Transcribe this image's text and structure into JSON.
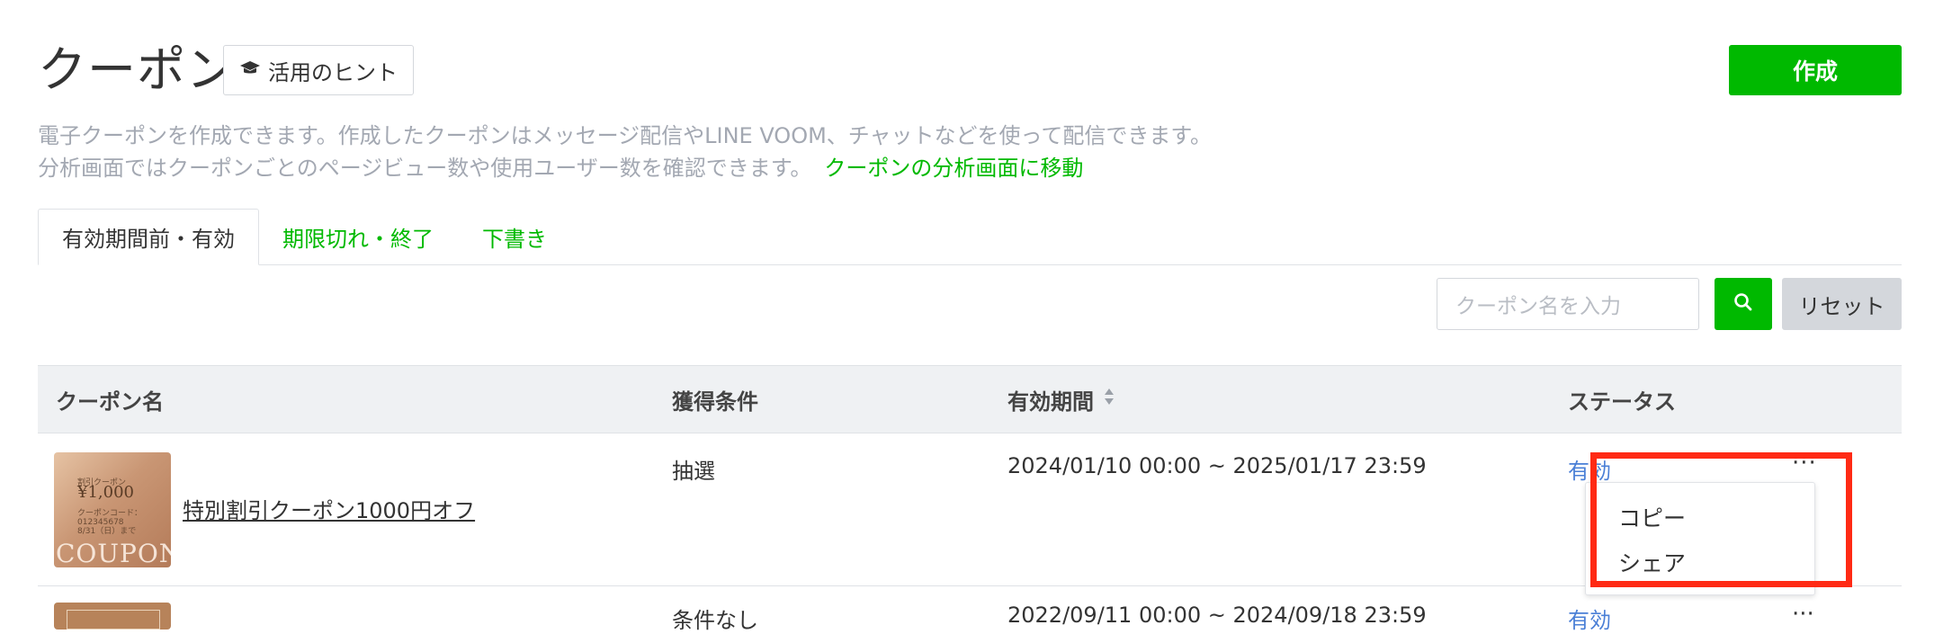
{
  "header": {
    "title": "クーポン",
    "hint_label": "活用のヒント",
    "create_label": "作成"
  },
  "description": {
    "line1": "電子クーポンを作成できます。作成したクーポンはメッセージ配信やLINE VOOM、チャットなどを使って配信できます。",
    "line2": "分析画面ではクーポンごとのページビュー数や使用ユーザー数を確認できます。",
    "link": "クーポンの分析画面に移動"
  },
  "tabs": [
    {
      "label": "有効期間前・有効",
      "active": true
    },
    {
      "label": "期限切れ・終了",
      "active": false
    },
    {
      "label": "下書き",
      "active": false
    }
  ],
  "search": {
    "placeholder": "クーポン名を入力",
    "reset_label": "リセット"
  },
  "table": {
    "headers": {
      "name": "クーポン名",
      "condition": "獲得条件",
      "period": "有効期間",
      "status": "ステータス"
    },
    "rows": [
      {
        "thumb_text": {
          "label": "割引クーポン",
          "price": "¥1,000",
          "code": "クーポンコード：012345678",
          "date": "8/31（日）まで",
          "watermark": "COUPON"
        },
        "name": "特別割引クーポン1000円オフ",
        "condition": "抽選",
        "period": "2024/01/10 00:00 ~ 2025/01/17 23:59",
        "status": "有効"
      },
      {
        "name": "",
        "condition": "条件なし",
        "period": "2022/09/11 00:00 ~ 2024/09/18 23:59",
        "status": "有効"
      }
    ]
  },
  "context_menu": {
    "items": [
      "コピー",
      "シェア"
    ]
  },
  "more_glyph": "···",
  "colors": {
    "brand_green": "#00b900",
    "link_blue": "#4a7fd6",
    "highlight_red": "#ff2a14",
    "muted_text": "#a3a8b2"
  },
  "icons": {
    "hint": "graduation-cap-icon",
    "search": "search-icon",
    "sort": "sort-icon",
    "more": "more-horizontal-icon"
  }
}
